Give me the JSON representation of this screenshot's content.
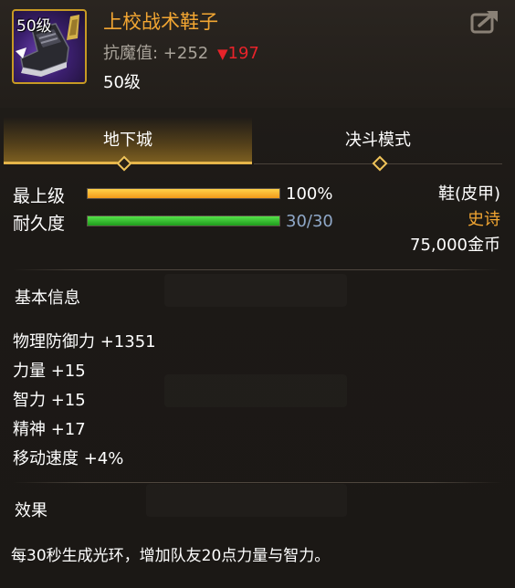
{
  "item": {
    "level_badge": "50级",
    "name": "上校战术鞋子",
    "anti_magic_label": "抗魔值: +252",
    "anti_magic_down": "197",
    "required_level": "50级"
  },
  "tabs": [
    {
      "label": "地下城",
      "active": true
    },
    {
      "label": "决斗模式",
      "active": false
    }
  ],
  "stats": {
    "grade_label": "最上级",
    "grade_value": "100%",
    "grade_fraction": 1.0,
    "durability_label": "耐久度",
    "durability_value": "30/30",
    "durability_fraction": 1.0
  },
  "meta": {
    "type": "鞋(皮甲)",
    "rarity": "史诗",
    "price": "75,000金币"
  },
  "basic_info": {
    "title": "基本信息",
    "lines": [
      "物理防御力 +1351",
      "力量 +15",
      "智力 +15",
      "精神 +17",
      "移动速度 +4%"
    ]
  },
  "effect": {
    "title": "效果",
    "text": "每30秒生成光环，增加队友20点力量与智力。"
  },
  "colors": {
    "item_name": "#f2a632",
    "rarity": "#f2a632",
    "down_arrow": "#e8232a",
    "durability_text": "#8fa8c8",
    "bar_grade": "#f29a1a",
    "bar_durability": "#1f9a1c"
  },
  "icons": {
    "item_icon": "boot-icon",
    "share": "share-icon",
    "down_arrow": "down-triangle-icon"
  }
}
